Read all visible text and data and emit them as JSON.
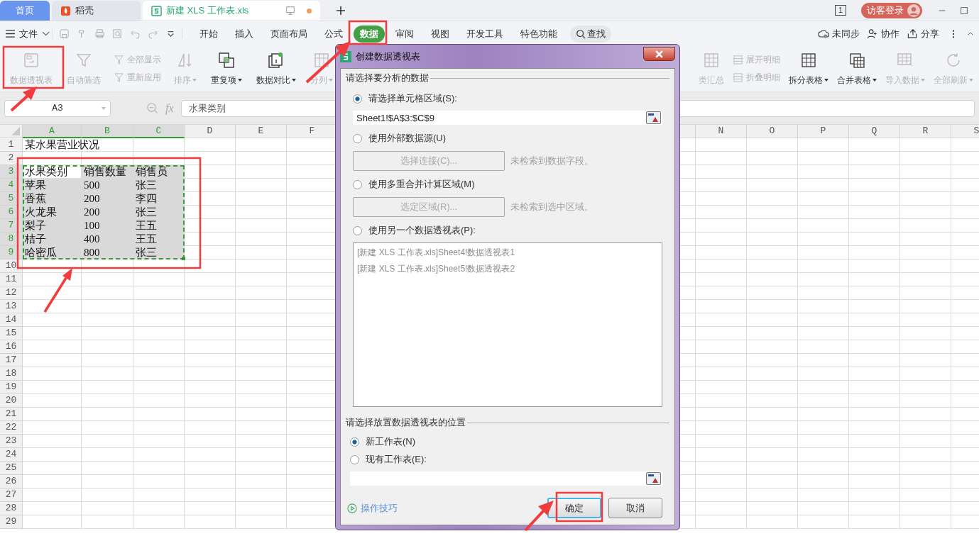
{
  "tabs": [
    {
      "label": "首页",
      "kind": "home",
      "selected": false
    },
    {
      "label": "稻壳",
      "kind": "docer",
      "selected": false
    },
    {
      "label": "新建 XLS 工作表.xls",
      "kind": "document",
      "selected": true,
      "unsaved": true
    }
  ],
  "title_bar": {
    "window_count": "1",
    "login": "访客登录"
  },
  "menu": {
    "file": "文件",
    "tabs": [
      {
        "label": "开始",
        "selected": false
      },
      {
        "label": "插入",
        "selected": false
      },
      {
        "label": "页面布局",
        "selected": false
      },
      {
        "label": "公式",
        "selected": false
      },
      {
        "label": "数据",
        "selected": true
      },
      {
        "label": "审阅",
        "selected": false
      },
      {
        "label": "视图",
        "selected": false
      },
      {
        "label": "开发工具",
        "selected": false
      },
      {
        "label": "特色功能",
        "selected": false
      }
    ],
    "search": "查找",
    "actions": [
      "未同步",
      "协作",
      "分享"
    ]
  },
  "ribbon": {
    "left": [
      {
        "kind": "large",
        "label": "数据透视表",
        "disabled": true,
        "dropdown": false
      },
      {
        "kind": "large",
        "label": "自动筛选",
        "disabled": true,
        "dropdown": false
      },
      {
        "kind": "stack",
        "items": [
          {
            "label": "全部显示",
            "disabled": true
          },
          {
            "label": "重新应用",
            "disabled": true
          }
        ]
      },
      {
        "kind": "large",
        "label": "排序",
        "disabled": true,
        "dropdown": true
      },
      {
        "kind": "large",
        "label": "重复项",
        "disabled": false,
        "dropdown": true
      },
      {
        "kind": "large",
        "label": "数据对比",
        "disabled": false,
        "dropdown": true
      },
      {
        "kind": "large",
        "label": "分列",
        "disabled": true,
        "dropdown": true
      }
    ],
    "right": [
      {
        "kind": "large",
        "label": "类汇总",
        "disabled": true,
        "dropdown": false
      },
      {
        "kind": "stack",
        "items": [
          {
            "label": "展开明细",
            "disabled": true
          },
          {
            "label": "折叠明细",
            "disabled": true
          }
        ]
      },
      {
        "kind": "large",
        "label": "拆分表格",
        "disabled": false,
        "dropdown": true
      },
      {
        "kind": "large",
        "label": "合并表格",
        "disabled": false,
        "dropdown": true
      },
      {
        "kind": "large",
        "label": "导入数据",
        "disabled": true,
        "dropdown": true
      },
      {
        "kind": "large",
        "label": "全部刷新",
        "disabled": true,
        "dropdown": true
      }
    ]
  },
  "formula_bar": {
    "cell": "A3",
    "fx": "fx",
    "value": "水果类别"
  },
  "sheet": {
    "columns_left": [
      {
        "label": "A",
        "selected": true
      },
      {
        "label": "B",
        "selected": true
      },
      {
        "label": "C",
        "selected": true
      },
      {
        "label": "D",
        "selected": false
      },
      {
        "label": "E",
        "selected": false
      },
      {
        "label": "F",
        "selected": false
      }
    ],
    "columns_right": [
      {
        "label": "N",
        "selected": false
      },
      {
        "label": "O",
        "selected": false
      },
      {
        "label": "P",
        "selected": false
      },
      {
        "label": "Q",
        "selected": false
      },
      {
        "label": "R",
        "selected": false
      },
      {
        "label": "S",
        "selected": false
      }
    ],
    "rows": [
      {
        "number": "1",
        "selected": false,
        "cells": [
          {
            "text": "某水果营业状况"
          }
        ]
      },
      {
        "number": "2",
        "selected": false
      },
      {
        "number": "3",
        "selected": true,
        "cells": [
          {
            "text": "水果类别",
            "active": true
          },
          {
            "text": "销售数量",
            "active": false
          },
          {
            "text": "销售员",
            "active": false
          }
        ]
      },
      {
        "number": "4",
        "selected": true,
        "cells": [
          {
            "text": "苹果",
            "active": false
          },
          {
            "text": "500",
            "active": false
          },
          {
            "text": "张三",
            "active": false
          }
        ]
      },
      {
        "number": "5",
        "selected": true,
        "cells": [
          {
            "text": "香蕉",
            "active": false
          },
          {
            "text": "200",
            "active": false
          },
          {
            "text": "李四",
            "active": false
          }
        ]
      },
      {
        "number": "6",
        "selected": true,
        "cells": [
          {
            "text": "火龙果",
            "active": false
          },
          {
            "text": "200",
            "active": false
          },
          {
            "text": "张三",
            "active": false
          }
        ]
      },
      {
        "number": "7",
        "selected": true,
        "cells": [
          {
            "text": "梨子",
            "active": false
          },
          {
            "text": "100",
            "active": false
          },
          {
            "text": "王五",
            "active": false
          }
        ]
      },
      {
        "number": "8",
        "selected": true,
        "cells": [
          {
            "text": "桔子",
            "active": false
          },
          {
            "text": "400",
            "active": false
          },
          {
            "text": "王五",
            "active": false
          }
        ]
      },
      {
        "number": "9",
        "selected": true,
        "cells": [
          {
            "text": "哈密瓜",
            "active": false
          },
          {
            "text": "800",
            "active": false
          },
          {
            "text": "张三",
            "active": false
          }
        ]
      },
      {
        "number": "10",
        "selected": false
      },
      {
        "number": "11",
        "selected": false
      },
      {
        "number": "12",
        "selected": false
      },
      {
        "number": "13",
        "selected": false
      },
      {
        "number": "14",
        "selected": false
      },
      {
        "number": "15",
        "selected": false
      },
      {
        "number": "16",
        "selected": false
      },
      {
        "number": "17",
        "selected": false
      },
      {
        "number": "18",
        "selected": false
      },
      {
        "number": "19",
        "selected": false
      },
      {
        "number": "20",
        "selected": false
      },
      {
        "number": "21",
        "selected": false
      },
      {
        "number": "22",
        "selected": false
      },
      {
        "number": "23",
        "selected": false
      },
      {
        "number": "24",
        "selected": false
      },
      {
        "number": "25",
        "selected": false
      },
      {
        "number": "26",
        "selected": false
      },
      {
        "number": "27",
        "selected": false
      },
      {
        "number": "28",
        "selected": false
      },
      {
        "number": "29",
        "selected": false
      }
    ]
  },
  "dialog": {
    "title": "创建数据透视表",
    "source_legend": "请选择要分析的数据",
    "source_options": [
      {
        "kind": "range",
        "label": "请选择单元格区域(S):",
        "selected": true,
        "value": "Sheet1!$A$3:$C$9"
      },
      {
        "kind": "button",
        "label": "使用外部数据源(U)",
        "selected": false,
        "button": "选择连接(C)...",
        "note": "未检索到数据字段。"
      },
      {
        "kind": "button",
        "label": "使用多重合并计算区域(M)",
        "selected": false,
        "button": "选定区域(R)...",
        "note": "未检索到选中区域。"
      },
      {
        "kind": "list",
        "label": "使用另一个数据透视表(P):",
        "selected": false,
        "items": [
          "[新建 XLS 工作表.xls]Sheet4!数据透视表1",
          "[新建 XLS 工作表.xls]Sheet5!数据透视表2"
        ]
      }
    ],
    "target_legend": "请选择放置数据透视表的位置",
    "target_options": [
      {
        "kind": "plain",
        "label": "新工作表(N)",
        "selected": true
      },
      {
        "kind": "range",
        "label": "现有工作表(E):",
        "selected": false
      }
    ],
    "tips": "操作技巧",
    "buttons": [
      {
        "label": "确定",
        "focused": true
      },
      {
        "label": "取消",
        "focused": false
      }
    ]
  }
}
